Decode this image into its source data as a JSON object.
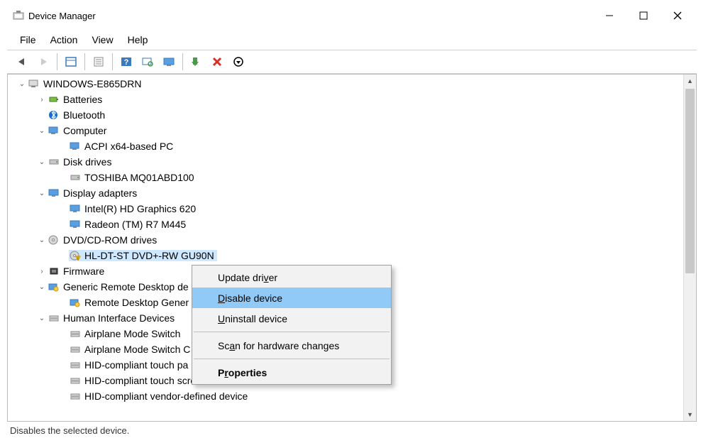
{
  "window": {
    "title": "Device Manager"
  },
  "menu": {
    "items": [
      "File",
      "Action",
      "View",
      "Help"
    ]
  },
  "toolbar": {
    "back": "back-icon",
    "forward": "forward-icon",
    "show_hidden": "show-hidden-icon",
    "properties": "properties-icon",
    "help": "help-icon",
    "scan": "scan-icon",
    "monitor": "monitor-icon",
    "install": "install-icon",
    "remove": "remove-icon",
    "uninstall": "uninstall-icon"
  },
  "tree": {
    "root": {
      "label": "WINDOWS-E865DRN",
      "expanded": true
    },
    "nodes": [
      {
        "label": "Batteries",
        "indent": 1,
        "expander": ">",
        "icon": "battery-icon"
      },
      {
        "label": "Bluetooth",
        "indent": 1,
        "expander": "",
        "icon": "bluetooth-icon"
      },
      {
        "label": "Computer",
        "indent": 1,
        "expander": "v",
        "icon": "computer-icon"
      },
      {
        "label": "ACPI x64-based PC",
        "indent": 2,
        "expander": "",
        "icon": "computer-icon"
      },
      {
        "label": "Disk drives",
        "indent": 1,
        "expander": "v",
        "icon": "disk-icon"
      },
      {
        "label": "TOSHIBA MQ01ABD100",
        "indent": 2,
        "expander": "",
        "icon": "disk-icon"
      },
      {
        "label": "Display adapters",
        "indent": 1,
        "expander": "v",
        "icon": "display-icon"
      },
      {
        "label": "Intel(R) HD Graphics 620",
        "indent": 2,
        "expander": "",
        "icon": "display-icon"
      },
      {
        "label": "Radeon (TM) R7 M445",
        "indent": 2,
        "expander": "",
        "icon": "display-icon"
      },
      {
        "label": "DVD/CD-ROM drives",
        "indent": 1,
        "expander": "v",
        "icon": "dvd-icon"
      },
      {
        "label": "HL-DT-ST DVD+-RW GU90N",
        "indent": 2,
        "expander": "",
        "icon": "dvd-warn-icon",
        "selected": true
      },
      {
        "label": "Firmware",
        "indent": 1,
        "expander": ">",
        "icon": "firmware-icon"
      },
      {
        "label": "Generic Remote Desktop de",
        "indent": 1,
        "expander": "v",
        "icon": "remote-icon",
        "truncated": true
      },
      {
        "label": "Remote Desktop Gener",
        "indent": 2,
        "expander": "",
        "icon": "remote-icon",
        "truncated": true
      },
      {
        "label": "Human Interface Devices",
        "indent": 1,
        "expander": "v",
        "icon": "hid-icon"
      },
      {
        "label": "Airplane Mode Switch",
        "indent": 2,
        "expander": "",
        "icon": "hid-icon"
      },
      {
        "label": "Airplane Mode Switch C",
        "indent": 2,
        "expander": "",
        "icon": "hid-icon",
        "truncated": true
      },
      {
        "label": "HID-compliant touch pa",
        "indent": 2,
        "expander": "",
        "icon": "hid-icon",
        "truncated": true
      },
      {
        "label": "HID-compliant touch screen",
        "indent": 2,
        "expander": "",
        "icon": "hid-icon"
      },
      {
        "label": "HID-compliant vendor-defined device",
        "indent": 2,
        "expander": "",
        "icon": "hid-icon"
      }
    ]
  },
  "context_menu": {
    "items": [
      {
        "label_pre": "Update dri",
        "underline": "v",
        "label_post": "er",
        "type": "normal"
      },
      {
        "label_pre": "",
        "underline": "D",
        "label_post": "isable device",
        "type": "highlighted"
      },
      {
        "label_pre": "",
        "underline": "U",
        "label_post": "ninstall device",
        "type": "normal"
      },
      {
        "type": "separator"
      },
      {
        "label_pre": "Sc",
        "underline": "a",
        "label_post": "n for hardware changes",
        "type": "normal"
      },
      {
        "type": "separator"
      },
      {
        "label_pre": "P",
        "underline": "r",
        "label_post": "operties",
        "type": "bold"
      }
    ]
  },
  "statusbar": {
    "text": "Disables the selected device."
  }
}
